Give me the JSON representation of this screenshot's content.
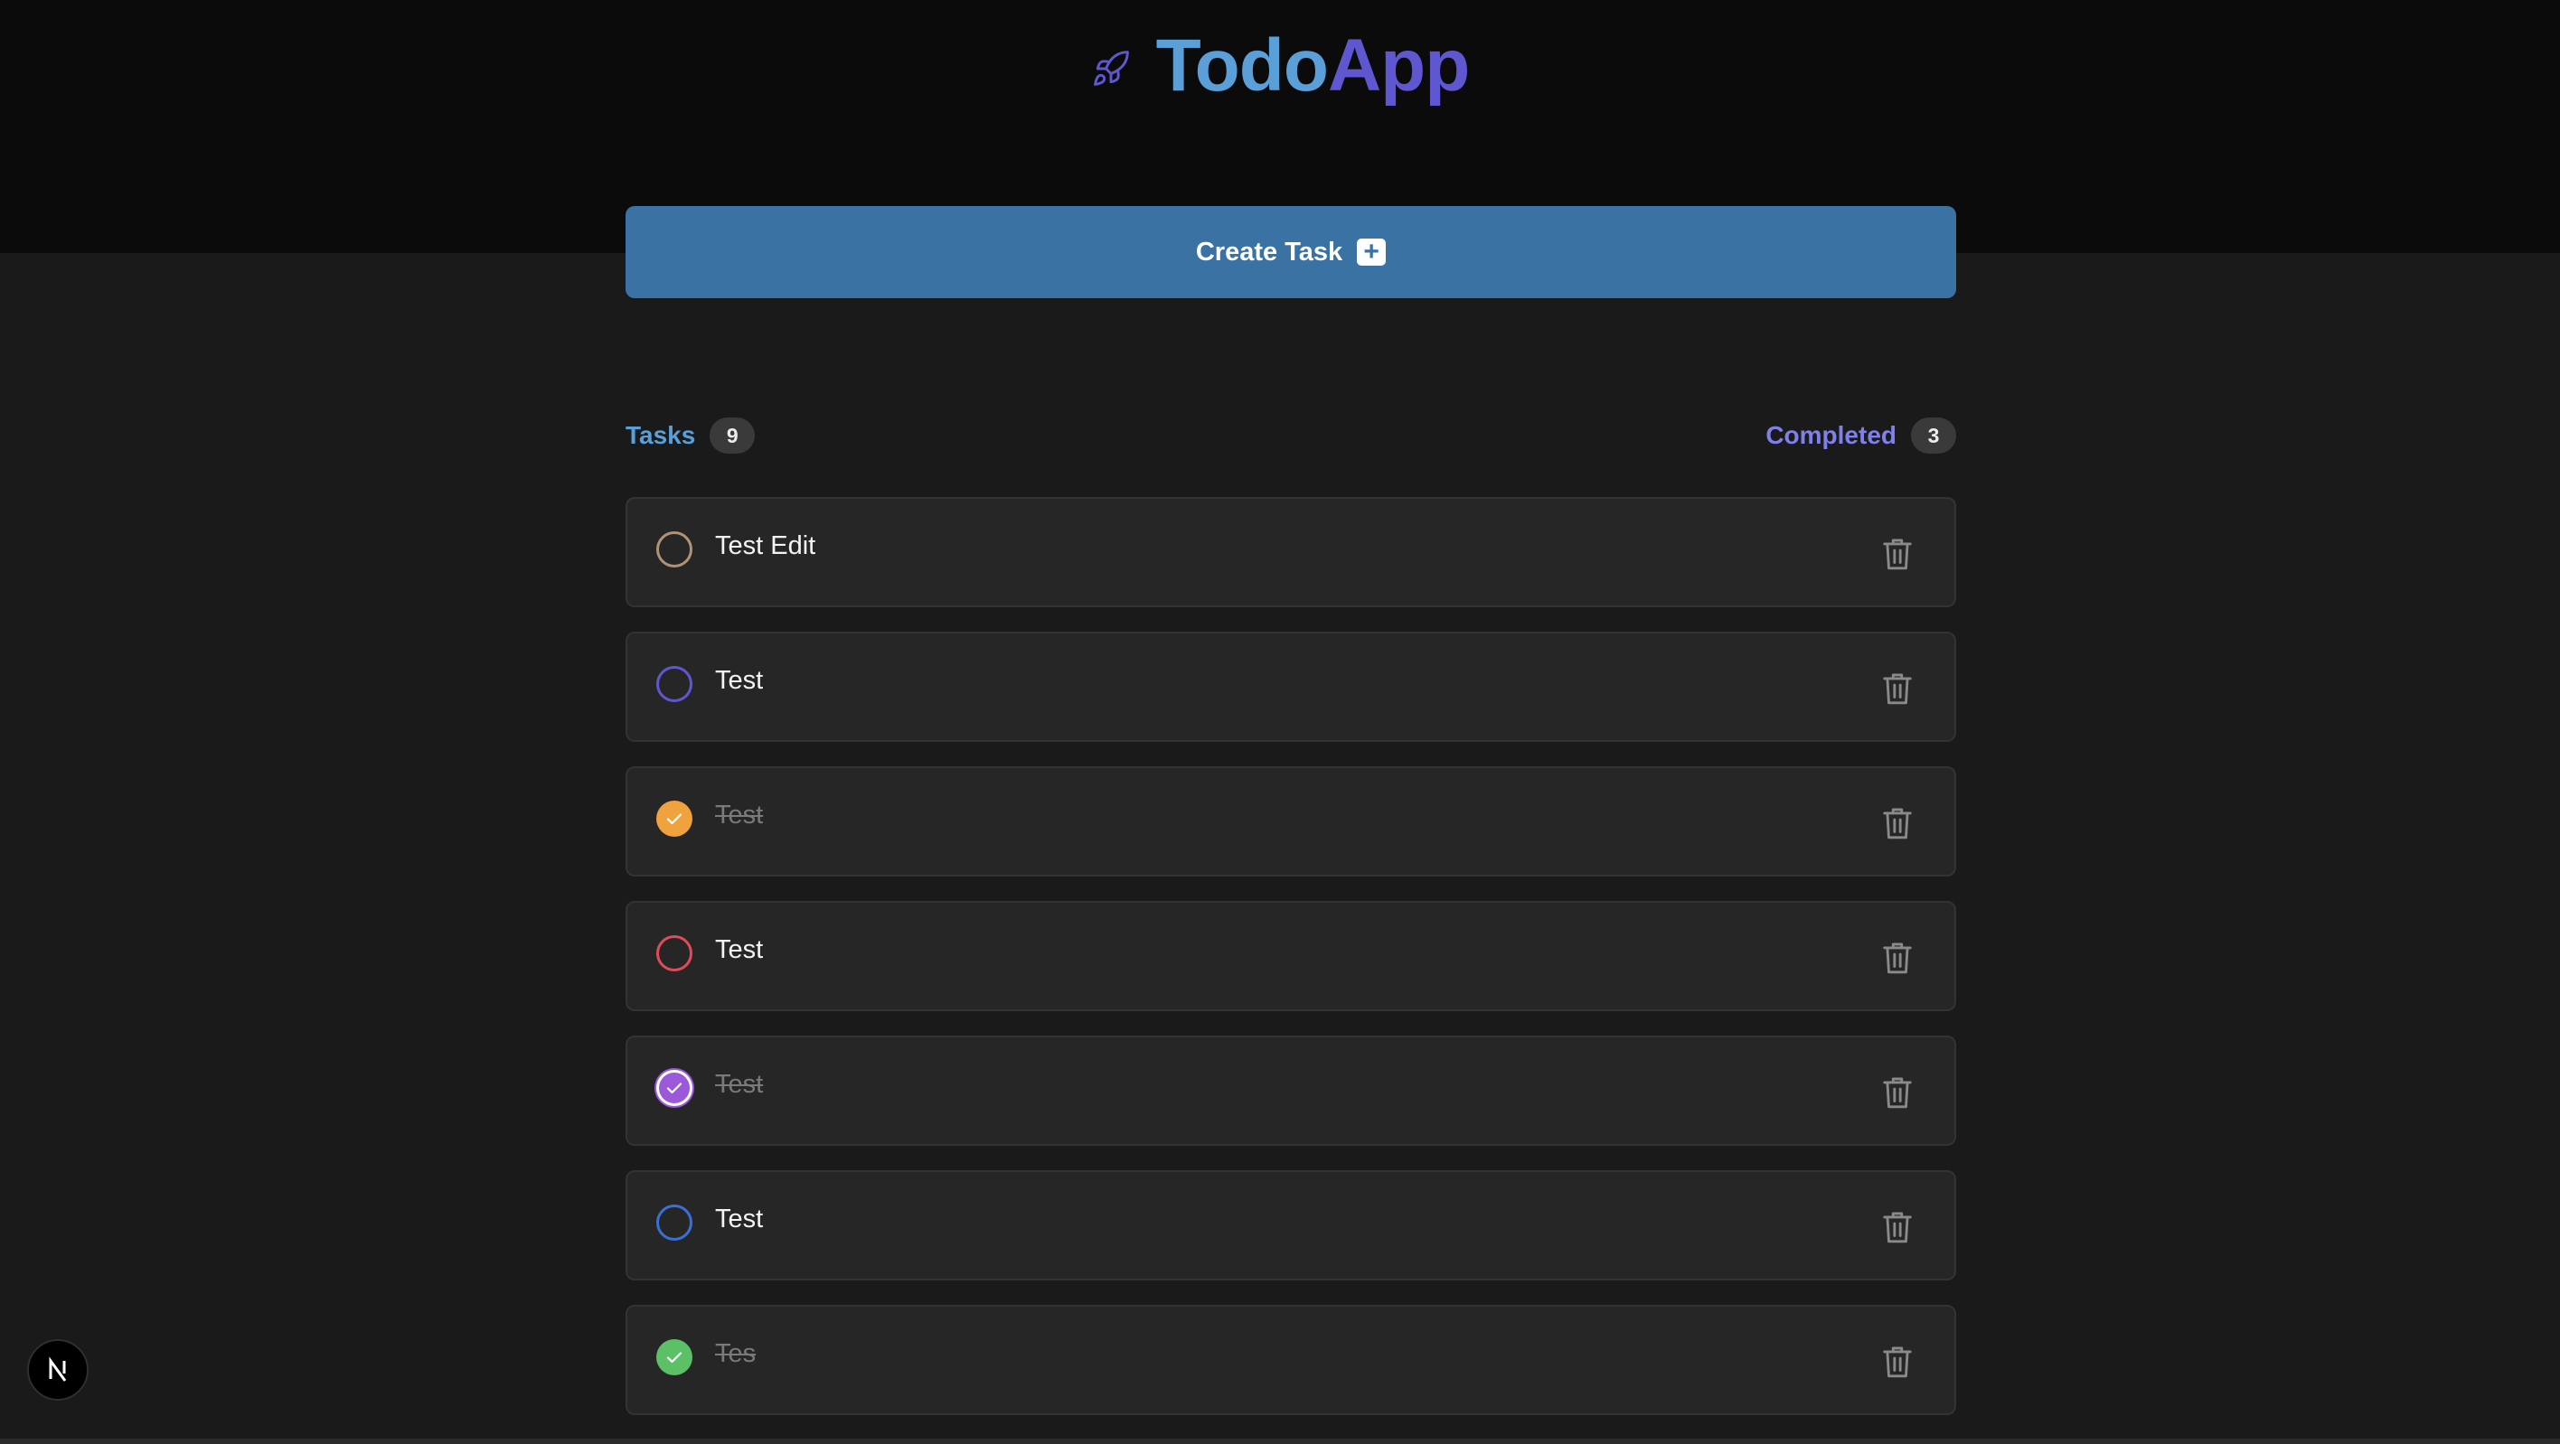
{
  "brand": {
    "icon": "rocket-icon",
    "title_part1": "Todo",
    "title_part2": "App"
  },
  "create_button": {
    "label": "Create Task",
    "icon": "plus-square-icon",
    "plus_glyph": "+"
  },
  "stats": {
    "tasks_label": "Tasks",
    "tasks_count": "9",
    "completed_label": "Completed",
    "completed_count": "3"
  },
  "tasks": [
    {
      "title": "Test Edit",
      "completed": false,
      "color": "#b09274"
    },
    {
      "title": "Test",
      "completed": false,
      "color": "#6056d2"
    },
    {
      "title": "Test",
      "completed": true,
      "color": "#f0a23c"
    },
    {
      "title": "Test",
      "completed": false,
      "color": "#e04a5a"
    },
    {
      "title": "Test",
      "completed": true,
      "color": "#9b59d9"
    },
    {
      "title": "Test",
      "completed": false,
      "color": "#3a6fd8"
    },
    {
      "title": "Tes",
      "completed": true,
      "color": "#5cc166"
    }
  ],
  "colors": {
    "header_bg": "#0b0b0c",
    "page_bg": "#1a1a1a",
    "accent_blue": "#3a72a3",
    "todo_blue": "#5a9fd8",
    "app_purple": "#5e57d0"
  },
  "nextjs_badge": {
    "icon": "nextjs-logo-icon",
    "glyph": "N"
  }
}
